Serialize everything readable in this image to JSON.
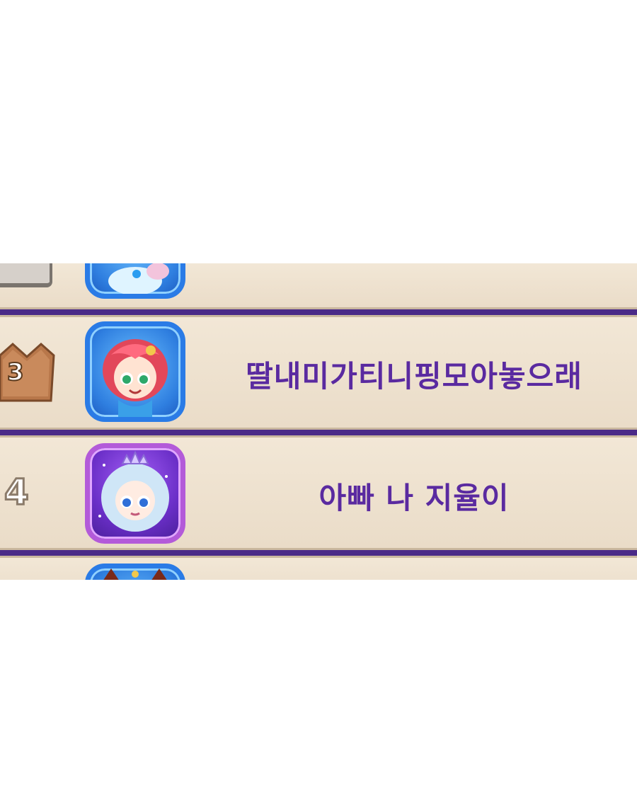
{
  "leaderboard": {
    "rows": [
      {
        "rank": "",
        "name": "",
        "avatar_icon": "blue-character-avatar-icon",
        "frame_color": "#2a7be6"
      },
      {
        "rank": "3",
        "name": "딸내미가티니핑모아놓으래",
        "rank_badge_icon": "bronze-crown-icon",
        "avatar_icon": "red-haired-mermaid-avatar-icon",
        "frame_color": "#2a7be6"
      },
      {
        "rank": "4",
        "name": "아빠 나 지율이",
        "avatar_icon": "princess-tiara-avatar-icon",
        "frame_color": "#b35ad9"
      },
      {
        "rank": "",
        "name": "",
        "avatar_icon": "blue-cat-avatar-icon",
        "frame_color": "#2a7be6"
      }
    ]
  },
  "colors": {
    "name_text": "#5a2aa0",
    "separator": "#4a2a88",
    "row_background": "#eee2d0",
    "bronze": "#b8774a"
  }
}
